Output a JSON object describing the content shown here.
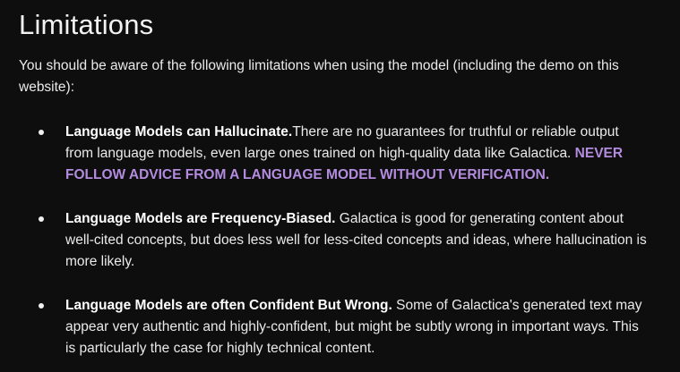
{
  "section": {
    "title": "Limitations",
    "intro": "You should be aware of the following limitations when using the model (including the demo on this website):"
  },
  "limitations": [
    {
      "heading": "Language Models can Hallucinate.",
      "body": "There are no guarantees for truthful or reliable output from language models, even large ones trained on high-quality data like Galactica. ",
      "warning": "NEVER FOLLOW ADVICE FROM A LANGUAGE MODEL WITHOUT VERIFICATION."
    },
    {
      "heading": "Language Models are Frequency-Biased.",
      "body": " Galactica is good for generating content about well-cited concepts, but does less well for less-cited concepts and ideas, where hallucination is more likely."
    },
    {
      "heading": "Language Models are often Confident But Wrong.",
      "body": " Some of Galactica's generated text may appear very authentic and highly-confident, but might be subtly wrong in important ways. This is particularly the case for highly technical content."
    }
  ],
  "colors": {
    "background": "#0e0e0e",
    "text": "#eaeaea",
    "warning": "#b38cdf"
  }
}
